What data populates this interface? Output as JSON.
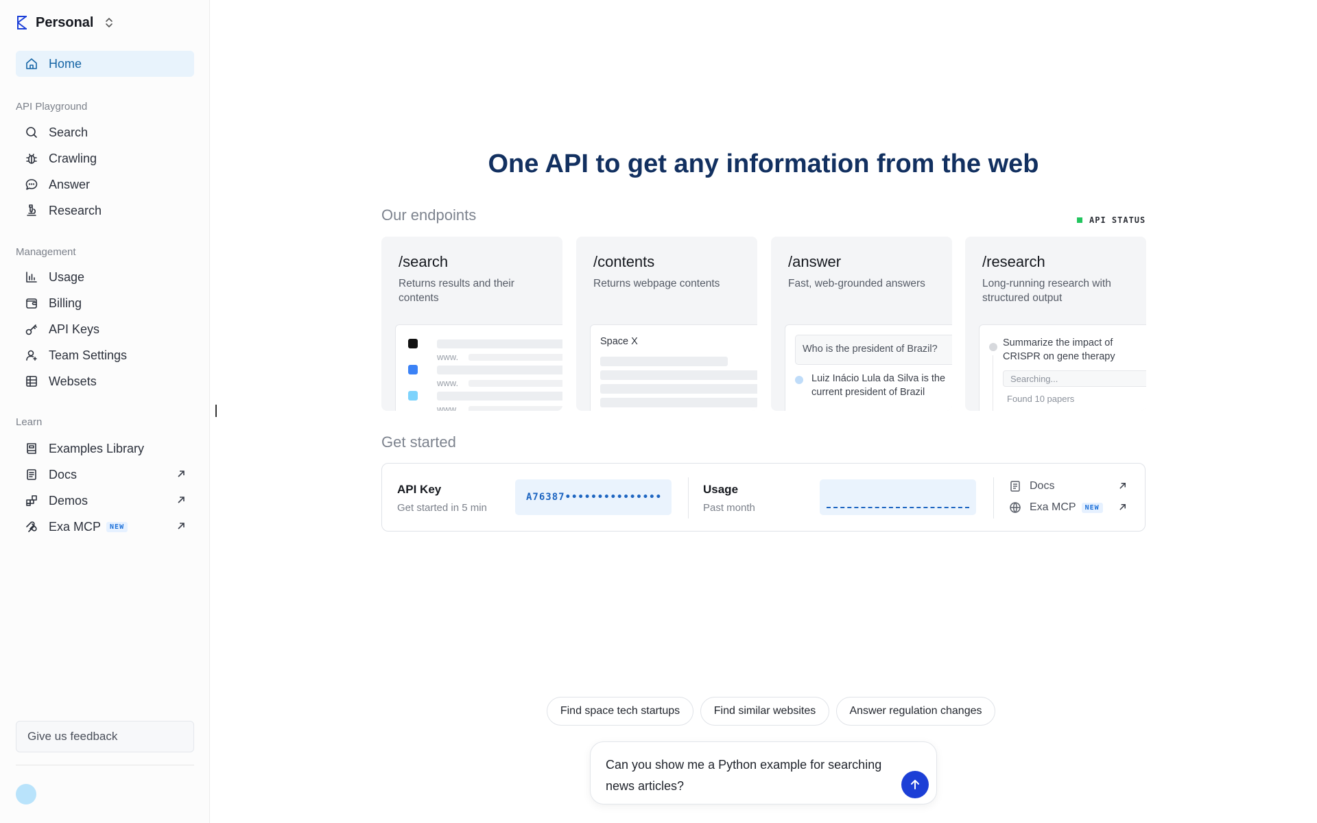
{
  "workspace": {
    "name": "Personal"
  },
  "sidebar": {
    "home": "Home",
    "sections": {
      "playground": "API Playground",
      "management": "Management",
      "learn": "Learn"
    },
    "playground_items": [
      "Search",
      "Crawling",
      "Answer",
      "Research"
    ],
    "management_items": [
      "Usage",
      "Billing",
      "API Keys",
      "Team Settings",
      "Websets"
    ],
    "learn_items": [
      "Examples Library",
      "Docs",
      "Demos",
      "Exa MCP"
    ],
    "new_badge": "NEW",
    "feedback": "Give us feedback"
  },
  "main": {
    "headline": "One API to get any information from the web",
    "endpoints_title": "Our endpoints",
    "api_status": "API STATUS",
    "endpoints": [
      {
        "title": "/search",
        "desc": "Returns results and their contents",
        "www": "www."
      },
      {
        "title": "/contents",
        "desc": "Returns webpage contents",
        "sample": "Space X"
      },
      {
        "title": "/answer",
        "desc": "Fast, web-grounded answers",
        "question": "Who is the president of Brazil?",
        "answer": "Luiz Inácio Lula da Silva is the current president of Brazil"
      },
      {
        "title": "/research",
        "desc": "Long-running research with structured output",
        "prompt": "Summarize the impact of CRISPR on gene therapy",
        "status": "Searching...",
        "found": "Found 10 papers"
      }
    ],
    "get_started_title": "Get started",
    "get_started": {
      "api_key": {
        "title": "API Key",
        "sub": "Get started in 5 min",
        "value": "A76387•••••••••••••••"
      },
      "usage": {
        "title": "Usage",
        "sub": "Past month"
      },
      "links": [
        {
          "label": "Docs",
          "badge": ""
        },
        {
          "label": "Exa MCP",
          "badge": "NEW"
        }
      ]
    },
    "suggestions": [
      "Find space tech startups",
      "Find similar websites",
      "Answer regulation changes"
    ],
    "chat_input": "Can you show me a Python example for searching news articles?"
  },
  "colors": {
    "accent": "#1464a5",
    "send": "#1c3fd6",
    "status_ok": "#22c55e",
    "result_dots": [
      "#111111",
      "#3b82f6",
      "#7dd3fc"
    ]
  }
}
